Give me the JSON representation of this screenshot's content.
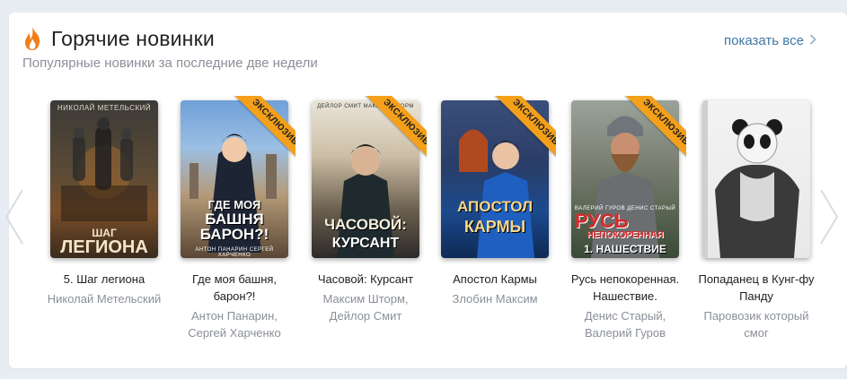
{
  "section": {
    "title": "Горячие новинки",
    "subtitle": "Популярные новинки за последние две недели",
    "show_all": "показать все",
    "show_all_icon": "chevron-right-icon",
    "title_icon": "fire-icon",
    "accent_color": "#f4a01a",
    "link_color": "#3f78a6"
  },
  "carousel": {
    "prev_icon": "chevron-left-icon",
    "next_icon": "chevron-right-icon"
  },
  "books": [
    {
      "title": "5. Шаг легиона",
      "author": "Николай Метельский",
      "cover_author": "НИКОЛАЙ МЕТЕЛЬСКИЙ",
      "cover_title_1": "ШАГ",
      "cover_title_2": "ЛЕГИОНА",
      "exclusive": false
    },
    {
      "title": "Где моя башня, барон?!",
      "author": "Антон Панарин, Сергей Харченко",
      "cover_title_1": "ГДЕ МОЯ",
      "cover_title_2": "БАШНЯ",
      "cover_title_3": "БАРОН?!",
      "cover_author": "АНТОН ПАНАРИН   СЕРГЕЙ ХАРЧЕНКО",
      "exclusive": true,
      "badge": "ЭКСКЛЮЗИВ"
    },
    {
      "title": "Часовой: Курсант",
      "author": "Максим Шторм, Дейлор Смит",
      "cover_author": "ДЕЙЛОР СМИТ   МАКСИМ ШТОРМ",
      "cover_title_1": "ЧАСОВОЙ:",
      "cover_title_2": "КУРСАНТ",
      "exclusive": true,
      "badge": "ЭКСКЛЮЗИВ"
    },
    {
      "title": "Апостол Кармы",
      "author": "Злобин Максим",
      "cover_title_1": "АПОСТОЛ",
      "cover_title_2": "КАРМЫ",
      "exclusive": true,
      "badge": "ЭКСКЛЮЗИВ"
    },
    {
      "title": "Русь непокоренная. Нашествие.",
      "author": "Денис Старый, Валерий Гуров",
      "cover_author": "ВАЛЕРИЙ ГУРОВ ДЕНИС СТАРЫЙ",
      "cover_title_1": "РУСЬ",
      "cover_title_2": "НЕПОКОРЕННАЯ",
      "cover_title_3": "1. НАШЕСТВИЕ",
      "exclusive": true,
      "badge": "ЭКСКЛЮЗИВ"
    },
    {
      "title": "Попаданец в Кунг-фу Панду",
      "author": "Паровозик который смог",
      "exclusive": false
    }
  ]
}
